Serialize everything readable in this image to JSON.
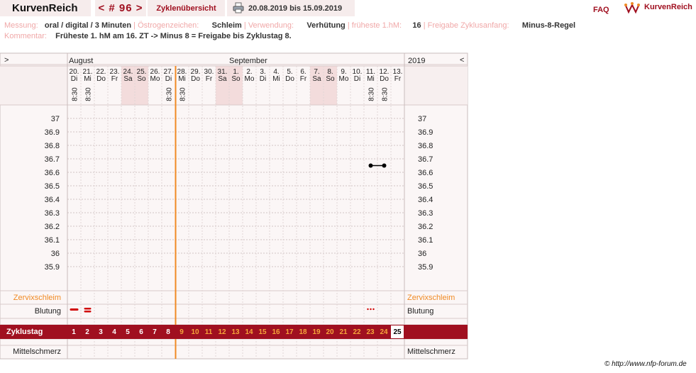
{
  "header": {
    "app_title": "KurvenReich",
    "cycle_nr": "< # 96 >",
    "overview_label": "Zyklenübersicht",
    "date_range": "20.08.2019 bis 15.09.2019",
    "faq_label": "FAQ",
    "logo_text": "KurvenReich"
  },
  "meta": {
    "messung_label": "Messung:",
    "messung_value": "oral / digital / 3 Minuten",
    "oestrogen_label": "Östrogenzeichen:",
    "oestrogen_value": "Schleim",
    "verwendung_label": "Verwendung:",
    "verwendung_value": "Verhütung",
    "fhm_label": "früheste 1.hM:",
    "fhm_value": "16",
    "freigabe_label": "Freigabe Zyklusanfang:",
    "freigabe_value": "Minus-8-Regel",
    "kommentar_label": "Kommentar:",
    "kommentar_value": "Früheste 1. hM am 16. ZT -> Minus 8 = Freigabe bis Zyklustag 8."
  },
  "grid": {
    "nav_left": ">",
    "nav_right": "<",
    "month1": "August",
    "month2": "September",
    "year": "2019",
    "days": [
      {
        "d": "20.",
        "w": "Di",
        "t": "8:30",
        "we": false
      },
      {
        "d": "21.",
        "w": "Mi",
        "t": "8:30",
        "we": false
      },
      {
        "d": "22.",
        "w": "Do",
        "t": "",
        "we": false
      },
      {
        "d": "23.",
        "w": "Fr",
        "t": "",
        "we": false
      },
      {
        "d": "24.",
        "w": "Sa",
        "t": "",
        "we": true
      },
      {
        "d": "25.",
        "w": "So",
        "t": "",
        "we": true
      },
      {
        "d": "26.",
        "w": "Mo",
        "t": "",
        "we": false
      },
      {
        "d": "27.",
        "w": "Di",
        "t": "8:30",
        "we": false
      },
      {
        "d": "28.",
        "w": "Mi",
        "t": "8:30",
        "we": false
      },
      {
        "d": "29.",
        "w": "Do",
        "t": "",
        "we": false
      },
      {
        "d": "30.",
        "w": "Fr",
        "t": "",
        "we": false
      },
      {
        "d": "31.",
        "w": "Sa",
        "t": "",
        "we": true
      },
      {
        "d": "1.",
        "w": "So",
        "t": "",
        "we": true
      },
      {
        "d": "2.",
        "w": "Mo",
        "t": "",
        "we": false
      },
      {
        "d": "3.",
        "w": "Di",
        "t": "",
        "we": false
      },
      {
        "d": "4.",
        "w": "Mi",
        "t": "",
        "we": false
      },
      {
        "d": "5.",
        "w": "Do",
        "t": "",
        "we": false
      },
      {
        "d": "6.",
        "w": "Fr",
        "t": "",
        "we": false
      },
      {
        "d": "7.",
        "w": "Sa",
        "t": "",
        "we": true
      },
      {
        "d": "8.",
        "w": "So",
        "t": "",
        "we": true
      },
      {
        "d": "9.",
        "w": "Mo",
        "t": "",
        "we": false
      },
      {
        "d": "10.",
        "w": "Di",
        "t": "",
        "we": false
      },
      {
        "d": "11.",
        "w": "Mi",
        "t": "8:30",
        "we": false
      },
      {
        "d": "12.",
        "w": "Do",
        "t": "8:30",
        "we": false
      },
      {
        "d": "13.",
        "w": "Fr",
        "t": "",
        "we": false
      }
    ],
    "temps": [
      "37",
      "36.9",
      "36.8",
      "36.7",
      "36.6",
      "36.5",
      "36.4",
      "36.3",
      "36.2",
      "36.1",
      "36",
      "35.9"
    ],
    "zervix_label": "Zervixschleim",
    "blutung_label": "Blutung",
    "zyklustag_label": "Zyklustag",
    "mittelschmerz_label": "Mittelschmerz",
    "zyklustage": [
      "1",
      "2",
      "3",
      "4",
      "5",
      "6",
      "7",
      "8",
      "9",
      "10",
      "11",
      "12",
      "13",
      "14",
      "15",
      "16",
      "17",
      "18",
      "19",
      "20",
      "21",
      "22",
      "23",
      "24",
      "25"
    ],
    "freigabe_bis_tag": 8,
    "colors": {
      "accent": "#a01020",
      "orange": "#f08a24",
      "weekend": "#f3dcdc",
      "grid": "#d0c4c4"
    }
  },
  "chart_data": {
    "type": "line",
    "title": "",
    "xlabel": "Zyklustag",
    "ylabel": "",
    "ylim": [
      35.9,
      37
    ],
    "series": [
      {
        "points": [
          {
            "x": 23,
            "y": 36.65
          },
          {
            "x": 24,
            "y": 36.65
          }
        ]
      }
    ],
    "blutung": [
      {
        "x": 1,
        "level": "mittel"
      },
      {
        "x": 2,
        "level": "stark"
      },
      {
        "x": 23,
        "level": "schmierblutung"
      }
    ]
  },
  "footer": {
    "copyright": "© http://www.nfp-forum.de"
  }
}
